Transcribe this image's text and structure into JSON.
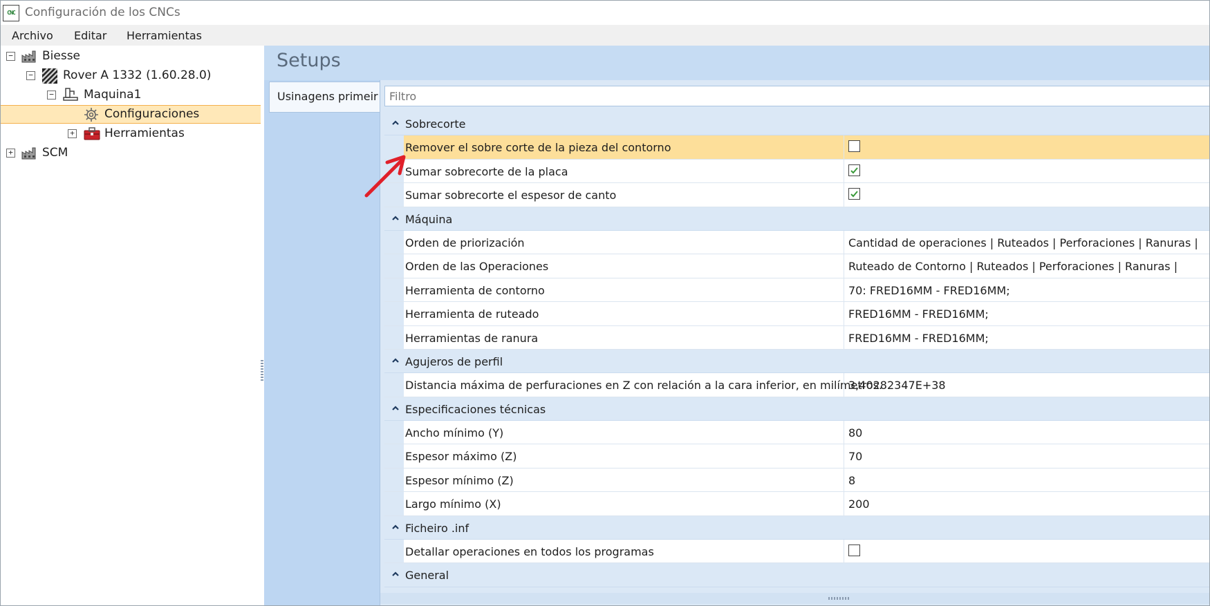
{
  "window": {
    "title": "Configuración de los CNCs",
    "icon_text": "CNC"
  },
  "menu": [
    "Archivo",
    "Editar",
    "Herramientas"
  ],
  "tree": [
    {
      "label": "Biesse",
      "expander": "−",
      "icon": "factory-icon"
    },
    {
      "label": "Rover A 1332 (1.60.28.0)",
      "expander": "−",
      "icon": "machine-model-icon"
    },
    {
      "label": "Maquina1",
      "expander": "−",
      "icon": "machine-icon"
    },
    {
      "label": "Configuraciones",
      "expander": "",
      "icon": "gear-icon",
      "selected": true
    },
    {
      "label": "Herramientas",
      "expander": "+",
      "icon": "toolbox-icon"
    },
    {
      "label": "SCM",
      "expander": "+",
      "icon": "factory-icon"
    }
  ],
  "panel": {
    "title": "Setups",
    "tab_label": "Usinagens primeir",
    "filter_placeholder": "Filtro"
  },
  "categories": [
    {
      "name": "Sobrecorte",
      "rows": [
        {
          "name": "Remover el sobre corte de la pieza del contorno",
          "type": "checkbox",
          "checked": false,
          "highlight": true
        },
        {
          "name": "Sumar sobrecorte de la placa",
          "type": "checkbox",
          "checked": true
        },
        {
          "name": "Sumar sobrecorte el espesor de canto",
          "type": "checkbox",
          "checked": true
        }
      ]
    },
    {
      "name": "Máquina",
      "rows": [
        {
          "name": "Orden de priorización",
          "value": "Cantidad de operaciones | Ruteados | Perforaciones | Ranuras |"
        },
        {
          "name": "Orden de las Operaciones",
          "value": "Ruteado de Contorno | Ruteados | Perforaciones | Ranuras |"
        },
        {
          "name": "Herramienta de contorno",
          "value": "70: FRED16MM - FRED16MM;"
        },
        {
          "name": "Herramienta de ruteado",
          "value": "FRED16MM - FRED16MM;"
        },
        {
          "name": "Herramientas de ranura",
          "value": "FRED16MM - FRED16MM;"
        }
      ]
    },
    {
      "name": "Agujeros de perfil",
      "rows": [
        {
          "name": "Distancia máxima de perfuraciones en Z con relación a la cara inferior, en milímetros.",
          "value": "3,40282347E+38"
        }
      ]
    },
    {
      "name": "Especificaciones técnicas",
      "rows": [
        {
          "name": "Ancho mínimo (Y)",
          "value": "80"
        },
        {
          "name": "Espesor máximo (Z)",
          "value": "70"
        },
        {
          "name": "Espesor mínimo (Z)",
          "value": "8"
        },
        {
          "name": "Largo mínimo (X)",
          "value": "200"
        }
      ]
    },
    {
      "name": "Ficheiro .inf",
      "rows": [
        {
          "name": "Detallar operaciones en todos los programas",
          "type": "checkbox",
          "checked": false
        }
      ]
    },
    {
      "name": "General",
      "rows": []
    }
  ],
  "colors": {
    "accent": "#f5b04c",
    "highlight_row": "#fddf9a",
    "check_green": "#3a9a3a",
    "annotation_arrow": "#e0202a"
  }
}
